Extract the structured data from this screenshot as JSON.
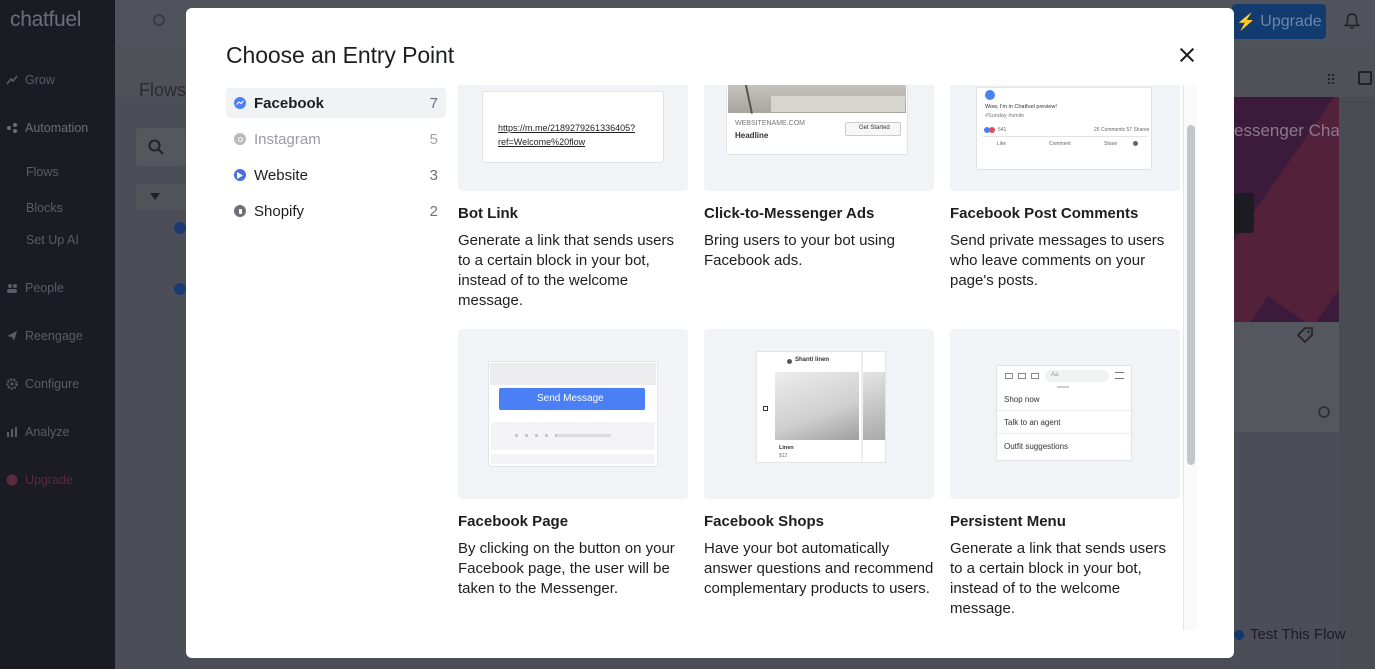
{
  "background": {
    "logo": "chatfuel",
    "nav": {
      "grow": "Grow",
      "automation": "Automation",
      "flows": "Flows",
      "blocks": "Blocks",
      "setup_ai": "Set Up AI",
      "people": "People",
      "reengage": "Reengage",
      "configure": "Configure",
      "analyze": "Analyze",
      "upgrade": "Upgrade"
    },
    "flows_title": "Flows",
    "upgrade_button": "Upgrade",
    "hero_title": "essenger Chat...",
    "test_flow_button": "Test This Flow"
  },
  "modal": {
    "title": "Choose an Entry Point",
    "categories": [
      {
        "label": "Facebook",
        "count": "7"
      },
      {
        "label": "Instagram",
        "count": "5"
      },
      {
        "label": "Website",
        "count": "3"
      },
      {
        "label": "Shopify",
        "count": "2"
      }
    ],
    "cards": [
      {
        "title": "Bot Link",
        "description": "Generate a link that sends users to a certain block in your bot, instead of to the welcome message."
      },
      {
        "title": "Click-to-Messenger Ads",
        "description": "Bring users to your bot using Facebook ads."
      },
      {
        "title": "Facebook Post Comments",
        "description": "Send private messages to users who leave comments on your page's posts."
      },
      {
        "title": "Facebook Page",
        "description": "By clicking on the button on your Facebook page, the user will be taken to the Messenger."
      },
      {
        "title": "Facebook Shops",
        "description": "Have your bot automatically answer questions and recommend complementary products to users."
      },
      {
        "title": "Persistent Menu",
        "description": "Generate a link that sends users to a certain block in your bot, instead of to the welcome message."
      }
    ],
    "previews": {
      "bot_link_url_line1": "https://m.me/2189279261336405?",
      "bot_link_url_line2": "ref=Welcome%20flow",
      "ads_site": "WEBSITENAME.COM",
      "ads_headline": "Headline",
      "ads_cta": "Get Started",
      "post_caption": "Wow, I'm in Chatfuel preview!",
      "post_tag": "#Sunday #smile",
      "post_count": "541",
      "post_stats": "26 Comments 57 Shares",
      "post_like": "Like",
      "post_comment": "Comment",
      "post_share": "Share",
      "page_button": "Send Message",
      "shop_name": "Shanti linen",
      "shop_item": "Linen",
      "shop_price": "$12",
      "menu_input_placeholder": "Aa",
      "menu_items": [
        "Shop now",
        "Talk to an agent",
        "Outfit suggestions"
      ]
    }
  },
  "colors": {
    "accent": "#4a7ff6",
    "sidebar_bg": "#1a1b23",
    "upgrade_bg": "#123b70"
  }
}
